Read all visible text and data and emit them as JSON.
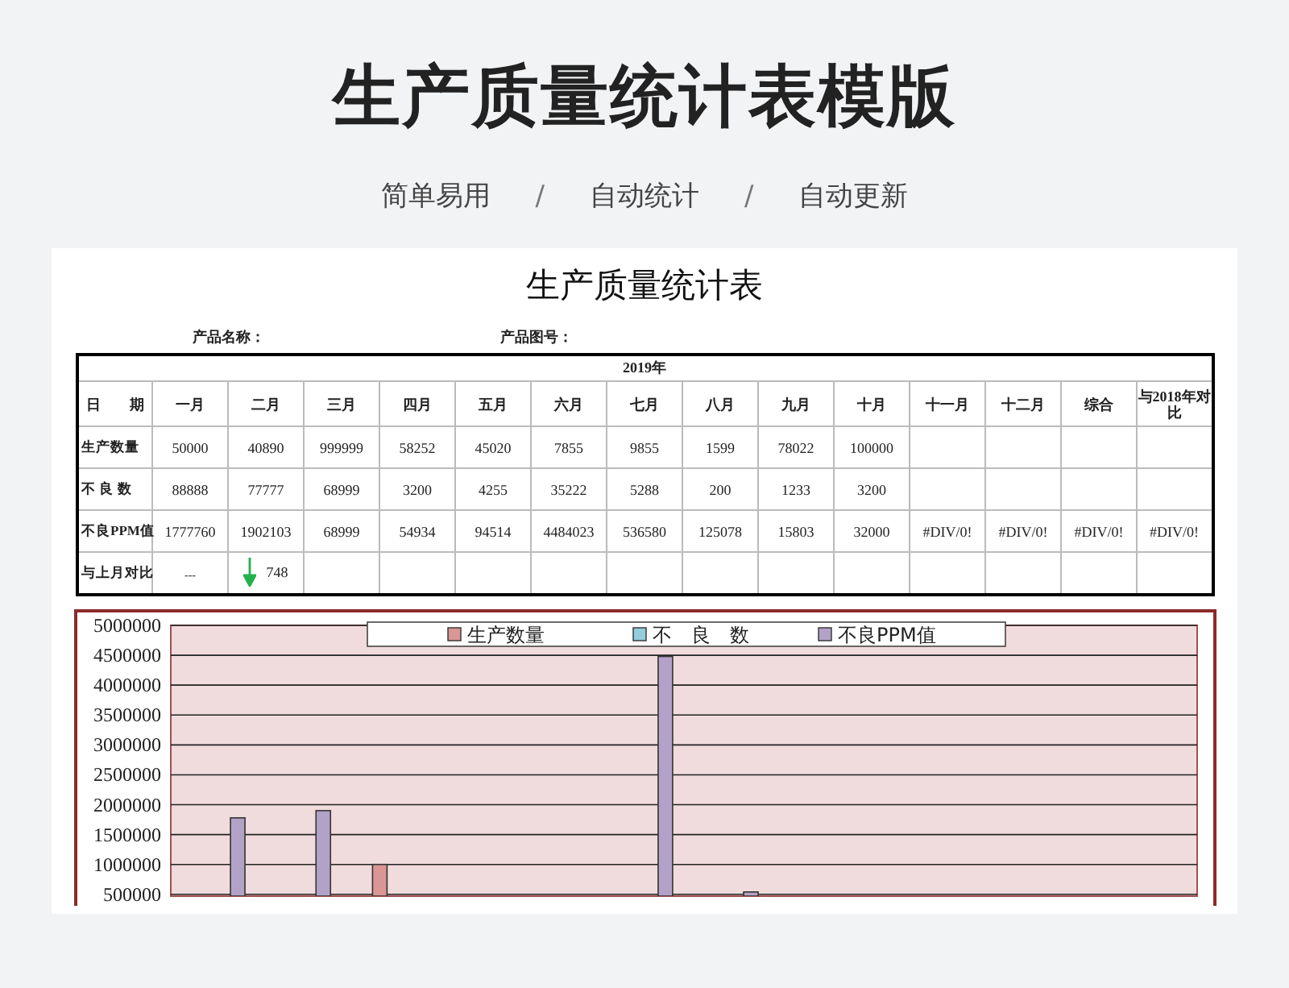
{
  "header": {
    "title": "生产质量统计表模版",
    "subtitle": [
      {
        "text": "简单易用",
        "kind": "tag"
      },
      {
        "text": "/",
        "kind": "separator"
      },
      {
        "text": "自动统计",
        "kind": "tag"
      },
      {
        "text": "/",
        "kind": "separator"
      },
      {
        "text": "自动更新",
        "kind": "tag"
      }
    ]
  },
  "sheet": {
    "title": "生产质量统计表",
    "fields": [
      "产品名称：",
      "产品图号："
    ],
    "table": {
      "year": "2019年",
      "columns": [
        "日　　期",
        "一月",
        "二月",
        "三月",
        "四月",
        "五月",
        "六月",
        "七月",
        "八月",
        "九月",
        "十月",
        "十一月",
        "十二月",
        "综合",
        "与2018年对比"
      ],
      "rows": [
        {
          "cells": [
            "生产数量",
            "50000",
            "40890",
            "999999",
            "58252",
            "45020",
            "7855",
            "9855",
            "1599",
            "78022",
            "100000"
          ]
        },
        {
          "cells": [
            "不 良 数",
            "88888",
            "77777",
            "68999",
            "3200",
            "4255",
            "35222",
            "5288",
            "200",
            "1233",
            "3200"
          ]
        },
        {
          "cells": [
            "不良PPM值",
            "1777760",
            "1902103",
            "68999",
            "54934",
            "94514",
            "4484023",
            "536580",
            "125078",
            "15803",
            "32000",
            "#DIV/0!",
            "#DIV/0!",
            "#DIV/0!",
            "#DIV/0!"
          ]
        },
        {
          "cells": [
            "与上月对比",
            {
              "text": "---"
            },
            {
              "text": "748",
              "decreased": true
            }
          ]
        }
      ]
    },
    "chart_data": {
      "type": "bar",
      "ylim": [
        470000,
        5000000
      ],
      "grid": true,
      "legend": true,
      "yticks": [
        500000,
        1000000,
        1500000,
        2000000,
        2500000,
        3000000,
        3500000,
        4000000,
        4500000,
        5000000
      ],
      "series": [
        {
          "name": "生产数量",
          "color": "#d99694",
          "values": [
            null,
            null,
            1000000,
            null,
            null,
            null,
            null,
            null,
            null,
            null,
            null,
            null
          ]
        },
        {
          "name": "不　良　数",
          "color": "#93cddd",
          "values": [
            null,
            null,
            null,
            null,
            null,
            null,
            null,
            null,
            null,
            null,
            null,
            null
          ]
        },
        {
          "name": "不良PPM值",
          "color": "#b3a2c7",
          "values": [
            1780000,
            1900000,
            null,
            null,
            null,
            4480000,
            540000,
            null,
            null,
            null,
            null,
            null
          ]
        }
      ]
    }
  }
}
